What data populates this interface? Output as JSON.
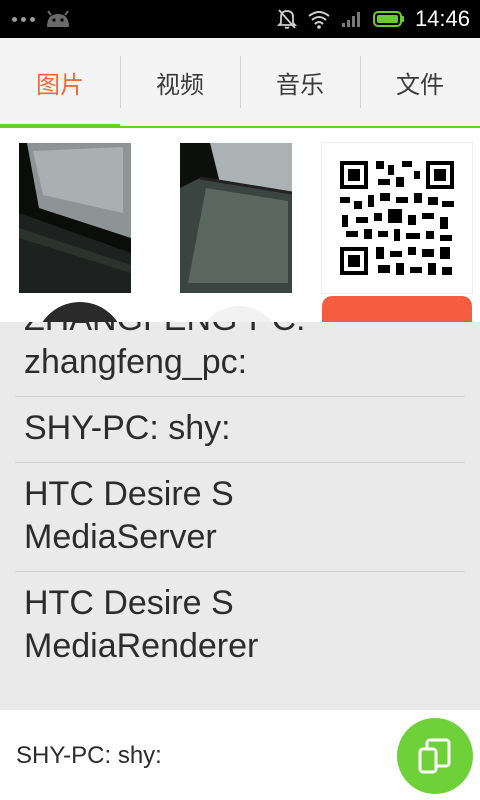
{
  "status_bar": {
    "time": "14:46",
    "icons": [
      "notification-dots",
      "android-icon",
      "mute-icon",
      "wifi-icon",
      "signal-icon",
      "battery-icon"
    ]
  },
  "tabs": [
    {
      "label": "图片",
      "active": true
    },
    {
      "label": "视频",
      "active": false
    },
    {
      "label": "音乐",
      "active": false
    },
    {
      "label": "文件",
      "active": false
    }
  ],
  "devices": [
    {
      "label": "ZHANGFENG-PC:\nzhangfeng_pc:"
    },
    {
      "label": "SHY-PC: shy:"
    },
    {
      "label": "HTC Desire S\nMediaServer"
    },
    {
      "label": "HTC Desire S\nMediaRenderer"
    }
  ],
  "bottom_bar": {
    "current_device": "SHY-PC: shy:"
  },
  "colors": {
    "accent_green": "#6ccc2e",
    "active_tab": "#f26a3c",
    "orange_card": "#f65c3f"
  }
}
